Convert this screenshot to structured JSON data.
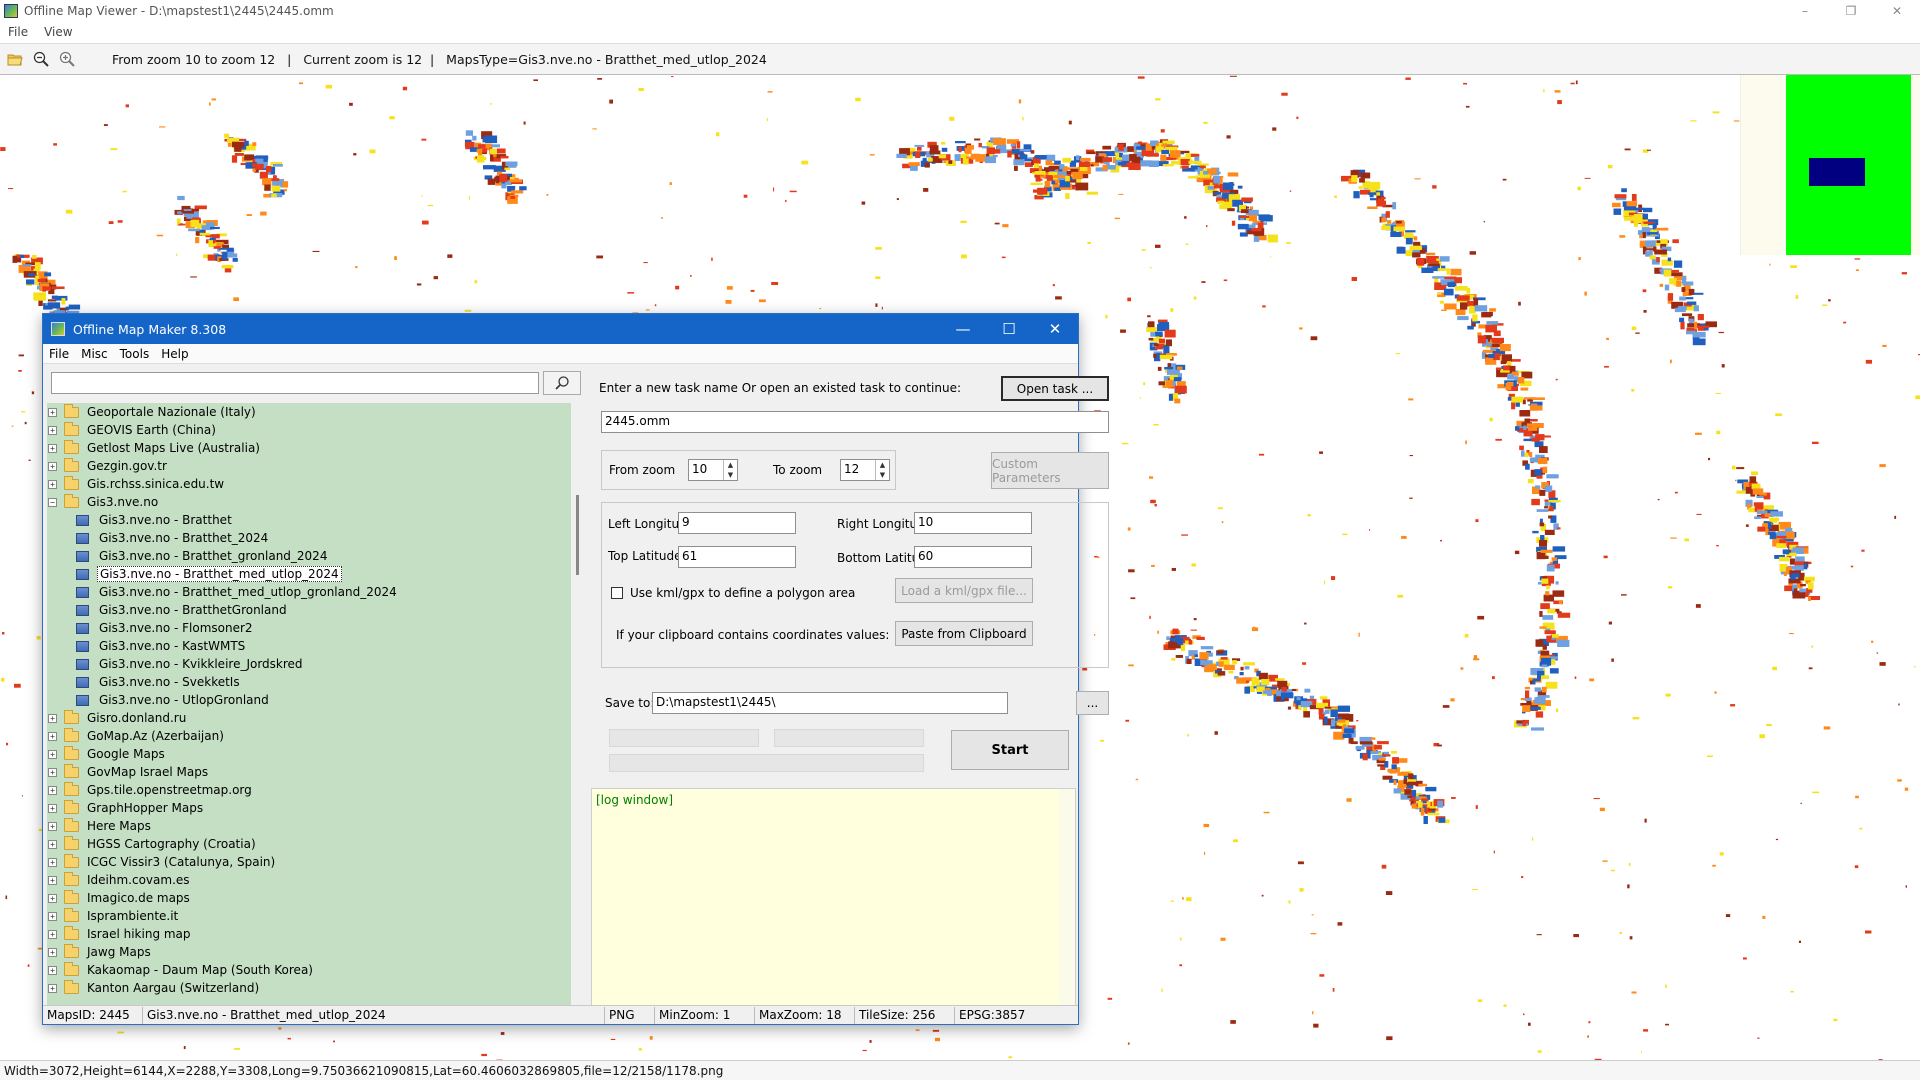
{
  "window": {
    "title": "Offline Map Viewer - D:\\mapstest1\\2445\\2445.omm",
    "controls": [
      "–",
      "❐",
      "✕"
    ]
  },
  "menu": [
    "File",
    "View"
  ],
  "toolbar": {
    "info": "From zoom 10 to zoom 12   |   Current zoom is 12  |   MapsType=Gis3.nve.no - Bratthet_med_utlop_2024",
    "icons": [
      "open-folder-icon",
      "zoom-out-icon",
      "zoom-in-icon"
    ]
  },
  "statusbar": "Width=3072,Height=6144,X=2288,Y=3308,Long=9.75036621090815,Lat=60.4606032869805,file=12/2158/1178.png",
  "dialog": {
    "title": "Offline Map Maker 8.308",
    "controls": [
      "—",
      "☐",
      "✕"
    ],
    "menu": [
      "File",
      "Misc",
      "Tools",
      "Help"
    ],
    "search": {
      "value": "",
      "placeholder": ""
    },
    "tree": [
      {
        "label": "Geoportale Nazionale (Italy)",
        "type": "folder",
        "expander": "+"
      },
      {
        "label": "GEOVIS Earth (China)",
        "type": "folder",
        "expander": "+"
      },
      {
        "label": "Getlost Maps Live (Australia)",
        "type": "folder",
        "expander": "+"
      },
      {
        "label": "Gezgin.gov.tr",
        "type": "folder",
        "expander": "+"
      },
      {
        "label": "Gis.rchss.sinica.edu.tw",
        "type": "folder",
        "expander": "+"
      },
      {
        "label": "Gis3.nve.no",
        "type": "folder-open",
        "expander": "−"
      },
      {
        "label": "Gis3.nve.no - Bratthet",
        "type": "map"
      },
      {
        "label": "Gis3.nve.no - Bratthet_2024",
        "type": "map"
      },
      {
        "label": "Gis3.nve.no - Bratthet_gronland_2024",
        "type": "map"
      },
      {
        "label": "Gis3.nve.no - Bratthet_med_utlop_2024",
        "type": "map",
        "selected": true
      },
      {
        "label": "Gis3.nve.no - Bratthet_med_utlop_gronland_2024",
        "type": "map"
      },
      {
        "label": "Gis3.nve.no - BratthetGronland",
        "type": "map"
      },
      {
        "label": "Gis3.nve.no - Flomsoner2",
        "type": "map"
      },
      {
        "label": "Gis3.nve.no - KastWMTS",
        "type": "map"
      },
      {
        "label": "Gis3.nve.no - Kvikkleire_Jordskred",
        "type": "map"
      },
      {
        "label": "Gis3.nve.no - SvekketIs",
        "type": "map"
      },
      {
        "label": "Gis3.nve.no - UtlopGronland",
        "type": "map"
      },
      {
        "label": "Gisro.donland.ru",
        "type": "folder",
        "expander": "+"
      },
      {
        "label": "GoMap.Az (Azerbaijan)",
        "type": "folder",
        "expander": "+"
      },
      {
        "label": "Google Maps",
        "type": "folder",
        "expander": "+"
      },
      {
        "label": "GovMap Israel Maps",
        "type": "folder",
        "expander": "+"
      },
      {
        "label": "Gps.tile.openstreetmap.org",
        "type": "folder",
        "expander": "+"
      },
      {
        "label": "GraphHopper Maps",
        "type": "folder",
        "expander": "+"
      },
      {
        "label": "Here Maps",
        "type": "folder",
        "expander": "+"
      },
      {
        "label": "HGSS Cartography (Croatia)",
        "type": "folder",
        "expander": "+"
      },
      {
        "label": "ICGC Vissir3 (Catalunya, Spain)",
        "type": "folder",
        "expander": "+"
      },
      {
        "label": "Ideihm.covam.es",
        "type": "folder",
        "expander": "+"
      },
      {
        "label": "Imagico.de maps",
        "type": "folder",
        "expander": "+"
      },
      {
        "label": "Isprambiente.it",
        "type": "folder",
        "expander": "+"
      },
      {
        "label": "Israel hiking map",
        "type": "folder",
        "expander": "+"
      },
      {
        "label": "Jawg Maps",
        "type": "folder",
        "expander": "+"
      },
      {
        "label": "Kakaomap - Daum Map (South Korea)",
        "type": "folder",
        "expander": "+"
      },
      {
        "label": "Kanton Aargau (Switzerland)",
        "type": "folder",
        "expander": "+"
      }
    ],
    "task_prompt": "Enter a new task name Or open an existed task to continue:",
    "open_task_button": "Open task ...",
    "task_name": "2445.omm",
    "from_zoom_label": "From zoom",
    "from_zoom_value": "10",
    "to_zoom_label": "To zoom",
    "to_zoom_value": "12",
    "custom_params_button": "Custom Parameters",
    "left_lon_label": "Left Longitude",
    "left_lon_value": "9",
    "right_lon_label": "Right Longitude",
    "right_lon_value": "10",
    "top_lat_label": "Top Latitude",
    "top_lat_value": "61",
    "bottom_lat_label": "Bottom Latitude",
    "bottom_lat_value": "60",
    "kml_checkbox_label": "Use kml/gpx to define a polygon area",
    "kml_checked": false,
    "load_kml_button": "Load a kml/gpx file...",
    "clipboard_label": "If your clipboard contains coordinates values:",
    "paste_button": "Paste from Clipboard",
    "save_to_label": "Save to:",
    "save_to_value": "D:\\mapstest1\\2445\\",
    "browse_button": "...",
    "start_button": "Start",
    "log_text": "[log window]",
    "status": {
      "maps_id": "MapsID: 2445",
      "maps_name": "Gis3.nve.no - Bratthet_med_utlop_2024",
      "format": "PNG",
      "min_zoom": "MinZoom: 1",
      "max_zoom": "MaxZoom: 18",
      "tile_size": "TileSize: 256",
      "epsg": "EPSG:3857"
    }
  },
  "colors": {
    "dialog_title": "#1565c8",
    "tree_bg": "#c5dfc5",
    "log_bg": "#ffffdd",
    "overview_green": "#00ff00",
    "overview_blue": "#000080",
    "map_hazard": [
      "#1f5fbf",
      "#6fa0e0",
      "#e23a1a",
      "#ff8a1a",
      "#f6e21a",
      "#9b2a12"
    ]
  }
}
